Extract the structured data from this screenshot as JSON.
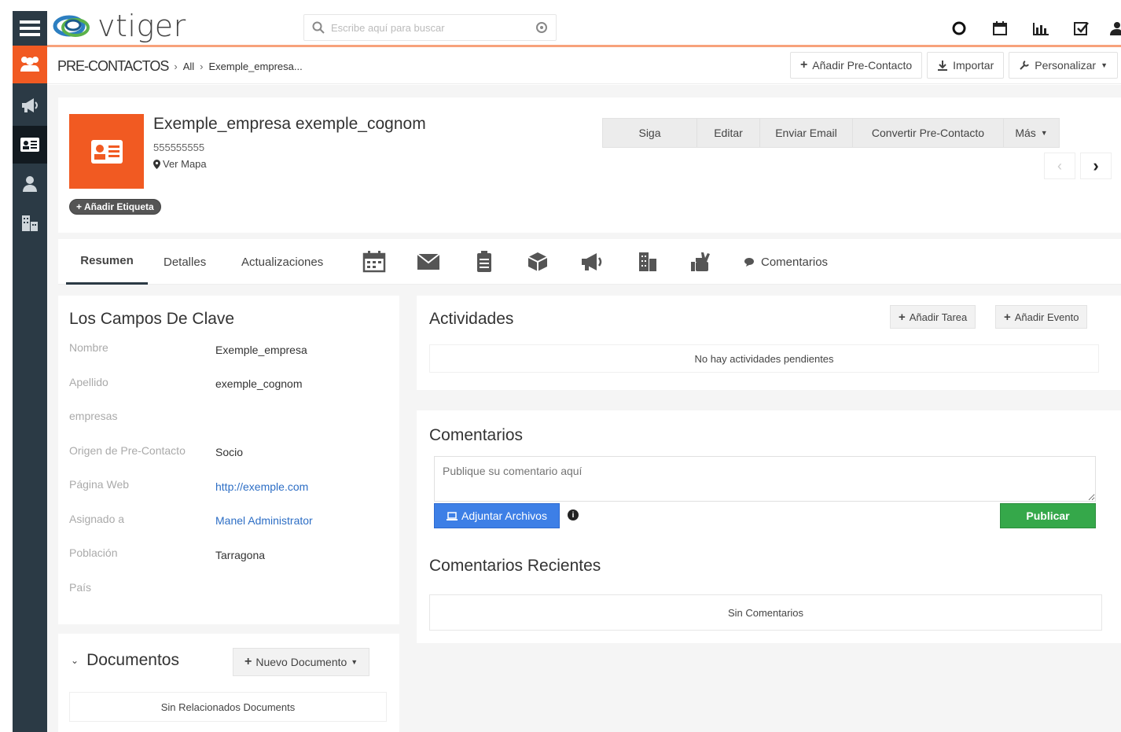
{
  "app": {
    "logo_text": "vtiger"
  },
  "search": {
    "placeholder": "Escribe aquí para buscar"
  },
  "breadcrumb": {
    "module": "PRE-CONTACTOS",
    "filter": "All",
    "record": "Exemple_empresa..."
  },
  "header_actions": {
    "add": "Añadir Pre-Contacto",
    "import": "Importar",
    "customize": "Personalizar"
  },
  "record": {
    "name": "Exemple_empresa exemple_cognom",
    "phone": "555555555",
    "map": "Ver Mapa",
    "add_tag": "Añadir Etiqueta"
  },
  "record_actions": {
    "follow": "Siga",
    "edit": "Editar",
    "email": "Enviar Email",
    "convert": "Convertir Pre-Contacto",
    "more": "Más"
  },
  "tabs": {
    "summary": "Resumen",
    "details": "Detalles",
    "updates": "Actualizaciones",
    "comments": "Comentarios"
  },
  "key_fields": {
    "title": "Los Campos De Clave",
    "fields": [
      {
        "label": "Nombre",
        "value": "Exemple_empresa"
      },
      {
        "label": "Apellido",
        "value": "exemple_cognom"
      },
      {
        "label": "empresas",
        "value": ""
      },
      {
        "label": "Origen de Pre-Contacto",
        "value": "Socio"
      },
      {
        "label": "Página Web",
        "value": "http://exemple.com"
      },
      {
        "label": "Asignado a",
        "value": "Manel Administrator"
      },
      {
        "label": "Población",
        "value": "Tarragona"
      },
      {
        "label": "País",
        "value": ""
      }
    ]
  },
  "documents": {
    "title": "Documentos",
    "new_button": "Nuevo Documento",
    "empty": "Sin Relacionados Documents"
  },
  "activities": {
    "title": "Actividades",
    "add_task": "Añadir Tarea",
    "add_event": "Añadir Evento",
    "empty": "No hay actividades pendientes"
  },
  "comments": {
    "title": "Comentarios",
    "placeholder": "Publique su comentario aquí",
    "attach": "Adjuntar Archivos",
    "publish": "Publicar",
    "recent_title": "Comentarios Recientes",
    "recent_empty": "Sin Comentarios"
  },
  "colors": {
    "accent": "#f15a22",
    "sidebar": "#2b3a45",
    "publish": "#35a84a",
    "attach": "#3d7fe6",
    "link": "#2d6ec5"
  }
}
